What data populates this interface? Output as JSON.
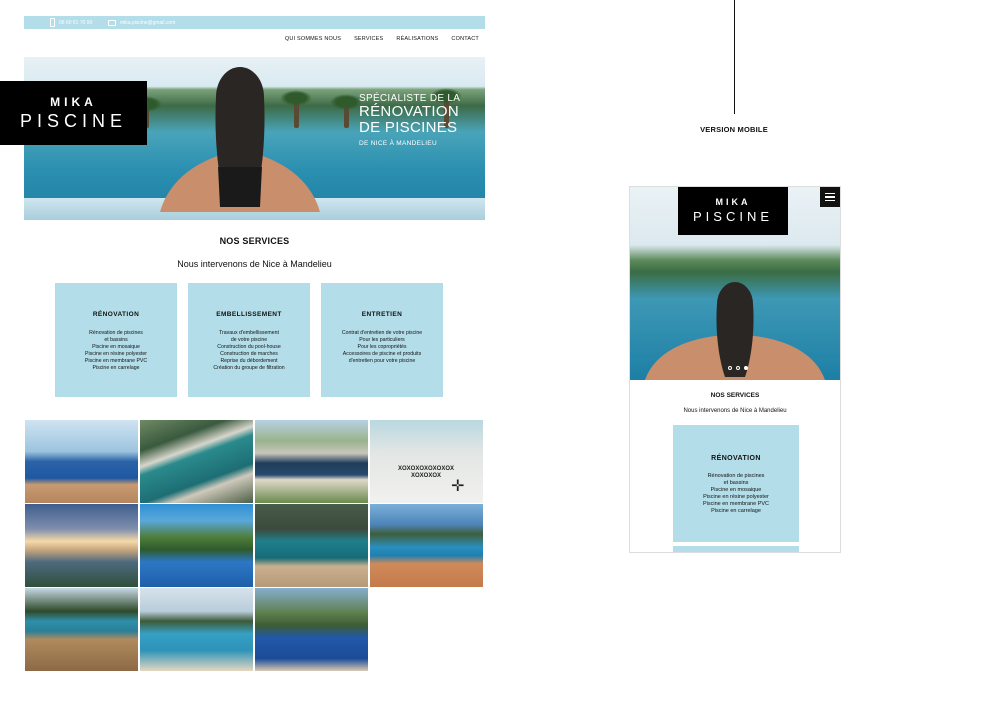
{
  "desktop": {
    "topbar": {
      "phone": "06 60 61 70 90",
      "email": "mika.piscine@gmail.com"
    },
    "nav": [
      "QUI SOMMES NOUS",
      "SERVICES",
      "RÉALISATIONS",
      "CONTACT"
    ],
    "logo": {
      "line1": "MIKA",
      "line2": "PISCINE"
    },
    "hero": {
      "line1": "SPÉCIALISTE DE LA",
      "line2": "RÉNOVATION",
      "line3": "DE PISCINES",
      "line4": "DE NICE À MANDELIEU"
    },
    "services": {
      "title": "NOS SERVICES",
      "subtitle": "Nous intervenons de Nice à Mandelieu",
      "cards": [
        {
          "title": "RÉNOVATION",
          "lines": [
            "Rénovation de piscines",
            "et bassins",
            "Piscine en mosaique",
            "Piscine en résine polyester",
            "Piscine en membrane PVC",
            "Piscine en carrelage"
          ]
        },
        {
          "title": "EMBELLISSEMENT",
          "lines": [
            "Travaux d'embellissement",
            "de votre piscine",
            "Construction du pool-house",
            "Construction de marches",
            "Reprise du débordement",
            "Création du groupe de filtration"
          ]
        },
        {
          "title": "ENTRETIEN",
          "lines": [
            "Contrat d'entretien de votre piscine",
            "Pour les particuliers",
            "Pour les copropriétés",
            "Accessoires de piscine et produits",
            "d'entretien pour votre piscine"
          ]
        }
      ]
    },
    "gallery": {
      "hover_text_1": "XOXOXOXOXOXOX",
      "hover_text_2": "XOXOXOX"
    }
  },
  "mobile": {
    "label": "VERSION MOBILE",
    "logo": {
      "line1": "MIKA",
      "line2": "PISCINE"
    },
    "services": {
      "title": "NOS SERVICES",
      "subtitle": "Nous intervenons de Nice à Mandelieu"
    },
    "card": {
      "title": "RÉNOVATION",
      "lines": [
        "Rénovation de piscines",
        "et bassins",
        "Piscine en mosaique",
        "Piscine en résine polyester",
        "Piscine en membrane PVC",
        "Piscine en carrelage"
      ]
    }
  },
  "colors": {
    "accent": "#b3dde8",
    "dark": "#000000"
  }
}
